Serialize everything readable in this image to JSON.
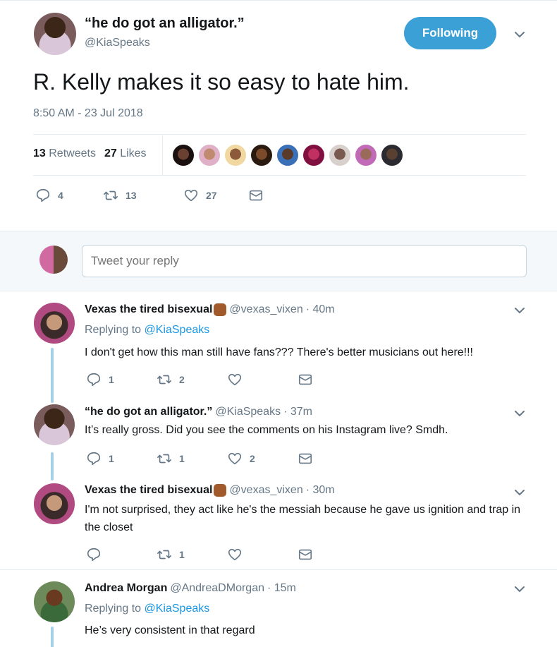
{
  "main_tweet": {
    "display_name": "“he do got an alligator.”",
    "handle": "@KiaSpeaks",
    "follow_label": "Following",
    "text": "R. Kelly makes it so easy to hate him.",
    "timestamp": "8:50 AM - 23 Jul 2018",
    "retweets_count": "13",
    "retweets_label": "Retweets",
    "likes_count": "27",
    "likes_label": "Likes",
    "actions": {
      "reply_count": "4",
      "retweet_count": "13",
      "like_count": "27"
    }
  },
  "reply_box": {
    "placeholder": "Tweet your reply"
  },
  "replies": [
    {
      "display_name": "Vexas the tired bisexual",
      "handle": "@vexas_vixen",
      "time": "· 40m",
      "replying_prefix": "Replying to",
      "replying_to": "@KiaSpeaks",
      "text": "I don't get how this man still have fans??? There's better musicians out here!!!",
      "reply_count": "1",
      "retweet_count": "2",
      "like_count": ""
    },
    {
      "display_name": "“he do got an alligator.”",
      "handle": "@KiaSpeaks",
      "time": "· 37m",
      "text": "It’s really gross. Did you see the comments on his Instagram live? Smdh.",
      "reply_count": "1",
      "retweet_count": "1",
      "like_count": "2"
    },
    {
      "display_name": "Vexas the tired bisexual",
      "handle": "@vexas_vixen",
      "time": "· 30m",
      "text": "I'm not surprised, they act like he's the messiah because he gave us ignition and trap in the closet",
      "reply_count": "",
      "retweet_count": "1",
      "like_count": ""
    },
    {
      "display_name": "Andrea Morgan",
      "handle": "@AndreaDMorgan",
      "time": "· 15m",
      "replying_prefix": "Replying to",
      "replying_to": "@KiaSpeaks",
      "text": "He’s very consistent in that regard"
    }
  ],
  "colors": {
    "accent": "#1b95e0",
    "follow_button": "#3aa0d6",
    "muted": "#657786",
    "thread_line": "#a6d0e8"
  },
  "icons": [
    "reply-icon",
    "retweet-icon",
    "heart-icon",
    "mail-icon",
    "chevron-down-icon",
    "raised-fist-emoji-icon"
  ]
}
